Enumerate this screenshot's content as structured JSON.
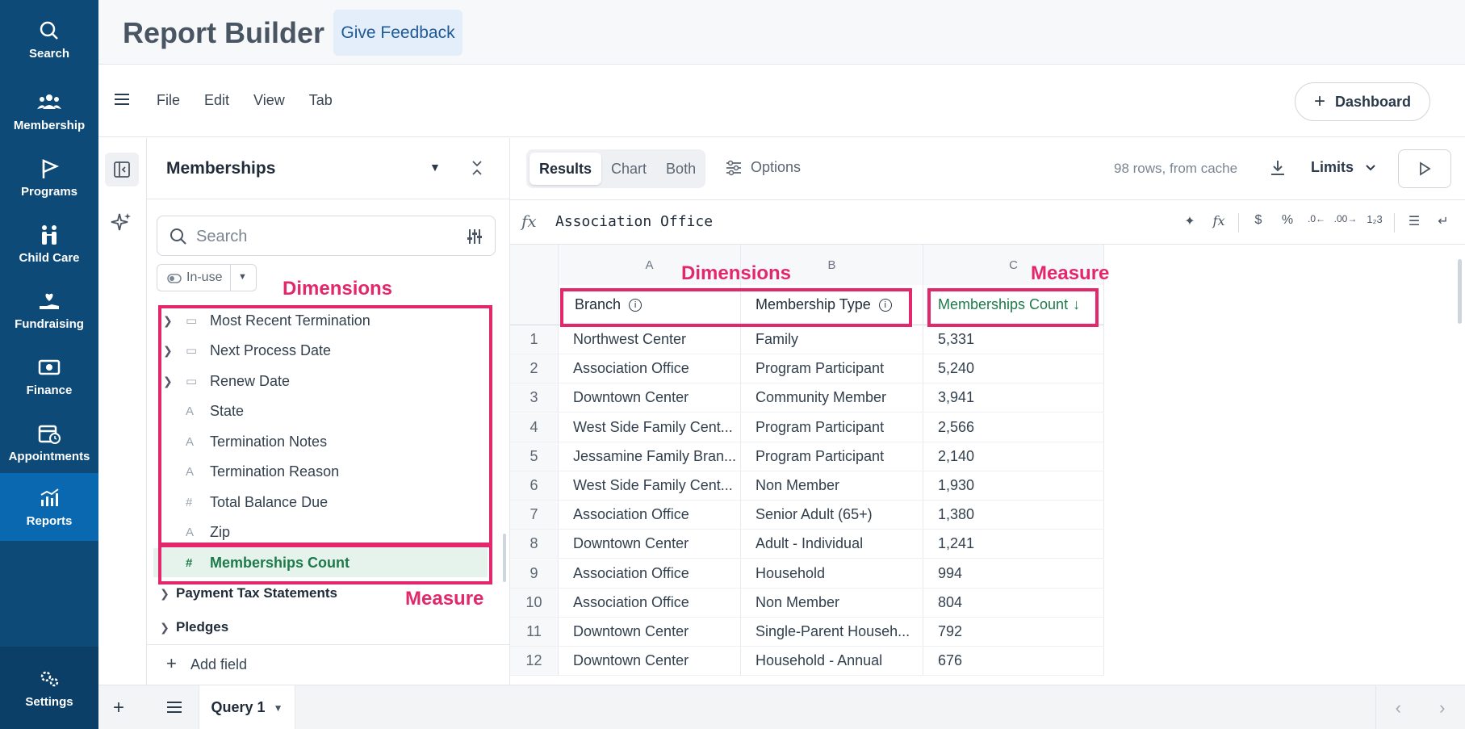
{
  "nav": {
    "items": [
      {
        "label": "Search",
        "icon": "search-icon"
      },
      {
        "label": "Membership",
        "icon": "people-icon"
      },
      {
        "label": "Programs",
        "icon": "flag-icon"
      },
      {
        "label": "Child Care",
        "icon": "child-care-icon"
      },
      {
        "label": "Fundraising",
        "icon": "heart-hand-icon"
      },
      {
        "label": "Finance",
        "icon": "money-icon"
      },
      {
        "label": "Appointments",
        "icon": "calendar-clock-icon"
      },
      {
        "label": "Reports",
        "icon": "chart-icon"
      }
    ],
    "active": "Reports",
    "settings_label": "Settings"
  },
  "header": {
    "title": "Report Builder",
    "feedback_label": "Give Feedback"
  },
  "menubar": {
    "items": [
      "File",
      "Edit",
      "View",
      "Tab"
    ],
    "dashboard_label": "Dashboard"
  },
  "panel": {
    "title": "Memberships",
    "search_placeholder": "Search",
    "filter_label": "In-use",
    "fields": [
      {
        "name": "Most Recent Termination",
        "type": "date",
        "expandable": true
      },
      {
        "name": "Next Process Date",
        "type": "date",
        "expandable": true
      },
      {
        "name": "Renew Date",
        "type": "date",
        "expandable": true
      },
      {
        "name": "State",
        "type": "text",
        "expandable": false
      },
      {
        "name": "Termination Notes",
        "type": "text",
        "expandable": false
      },
      {
        "name": "Termination Reason",
        "type": "text",
        "expandable": false
      },
      {
        "name": "Total Balance Due",
        "type": "number",
        "expandable": false
      },
      {
        "name": "Zip",
        "type": "text",
        "expandable": false
      },
      {
        "name": "Memberships Count",
        "type": "number",
        "expandable": false,
        "selected": true
      }
    ],
    "groups": [
      "Payment Tax Statements",
      "Pledges"
    ],
    "add_field_label": "Add field"
  },
  "annotations": {
    "dimensions_label": "Dimensions",
    "measure_label": "Measure",
    "color": "#e3276b"
  },
  "toolbar": {
    "tabs": [
      "Results",
      "Chart",
      "Both"
    ],
    "active_tab": "Results",
    "options_label": "Options",
    "rows_info": "98 rows, from cache",
    "limits_label": "Limits"
  },
  "formula": {
    "fx_label": "fx",
    "value": "Association Office"
  },
  "grid": {
    "column_letters": [
      "A",
      "B",
      "C"
    ],
    "headers": [
      "Branch",
      "Membership Type",
      "Memberships Count"
    ],
    "rows": [
      {
        "n": "1",
        "branch": "Northwest Center",
        "type": "Family",
        "count": "5,331"
      },
      {
        "n": "2",
        "branch": "Association Office",
        "type": "Program Participant",
        "count": "5,240"
      },
      {
        "n": "3",
        "branch": "Downtown Center",
        "type": "Community Member",
        "count": "3,941"
      },
      {
        "n": "4",
        "branch": "West Side Family Cent...",
        "type": "Program Participant",
        "count": "2,566"
      },
      {
        "n": "5",
        "branch": "Jessamine Family Bran...",
        "type": "Program Participant",
        "count": "2,140"
      },
      {
        "n": "6",
        "branch": "West Side Family Cent...",
        "type": "Non Member",
        "count": "1,930"
      },
      {
        "n": "7",
        "branch": "Association Office",
        "type": "Senior Adult (65+)",
        "count": "1,380"
      },
      {
        "n": "8",
        "branch": "Downtown Center",
        "type": "Adult - Individual",
        "count": "1,241"
      },
      {
        "n": "9",
        "branch": "Association Office",
        "type": "Household",
        "count": "994"
      },
      {
        "n": "10",
        "branch": "Association Office",
        "type": "Non Member",
        "count": "804"
      },
      {
        "n": "11",
        "branch": "Downtown Center",
        "type": "Single-Parent Househ...",
        "count": "792"
      },
      {
        "n": "12",
        "branch": "Downtown Center",
        "type": "Household - Annual",
        "count": "676"
      }
    ]
  },
  "bottombar": {
    "query_tab": "Query 1"
  },
  "colors": {
    "nav_bg": "#0d4a78",
    "nav_active": "#0a68b0",
    "measure_green": "#1d7a4a",
    "accent_blue": "#1e5a96"
  }
}
